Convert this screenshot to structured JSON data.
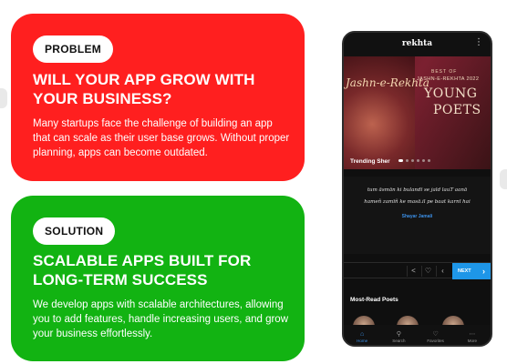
{
  "problem": {
    "badge": "PROBLEM",
    "title": "WILL YOUR APP GROW WITH YOUR BUSINESS?",
    "body": "Many startups face the challenge of building an app that can scale as their user base grows. Without proper planning, apps can become outdated."
  },
  "solution": {
    "badge": "SOLUTION",
    "title": "SCALABLE APPS BUILT FOR LONG-TERM SUCCESS",
    "body": "We develop apps with scalable architectures, allowing you to add features, handle increasing users, and grow your business effortlessly."
  },
  "colors": {
    "problem_bg": "#ff1f1f",
    "solution_bg": "#12b312",
    "accent_blue": "#1e96e8"
  },
  "phone": {
    "logo": "rekhta",
    "banner": {
      "jashn": "Jashn-e-Rekhta",
      "best_of": "BEST OF",
      "edition": "JASHN-E-REKHTA 2022",
      "young": "YOUNG",
      "poets": "POETS"
    },
    "trending_label": "Trending Sher",
    "sher_line1": "tum āsmān ki bulandī se jald lauT aanā",
    "sher_line2": "hameñ zamīñ ke masā.il pe baat karnī hai",
    "poet": "Shayar Jamali",
    "next_label": "NEXT",
    "most_read_label": "Most-Read Poets",
    "nav": [
      {
        "label": "Home",
        "icon": "home-icon"
      },
      {
        "label": "Search",
        "icon": "search-icon"
      },
      {
        "label": "Favorites",
        "icon": "heart-icon"
      },
      {
        "label": "More",
        "icon": "more-icon"
      }
    ]
  }
}
